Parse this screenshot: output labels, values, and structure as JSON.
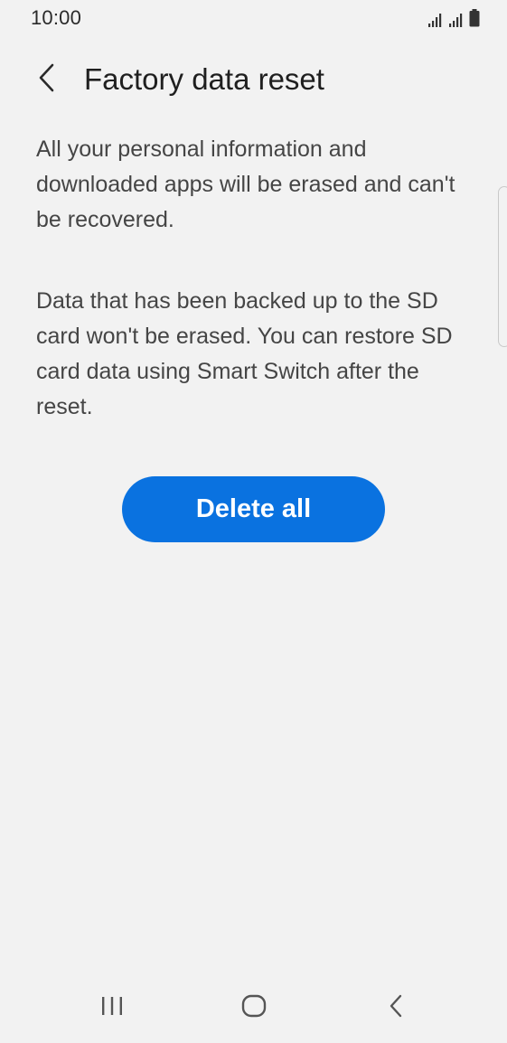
{
  "status_bar": {
    "time": "10:00",
    "icons": [
      "signal-icon",
      "signal-icon",
      "battery-icon"
    ]
  },
  "app_bar": {
    "back_icon": "chevron-left-icon",
    "title": "Factory data reset"
  },
  "content": {
    "paragraph_1": "All your personal information and downloaded apps will be erased and can't be recovered.",
    "paragraph_2": "Data that has been backed up to the SD card won't be erased. You can restore SD card data using Smart Switch after the reset."
  },
  "actions": {
    "delete_all_label": "Delete all"
  },
  "nav_bar": {
    "icons": [
      "recents-icon",
      "home-icon",
      "back-icon"
    ]
  },
  "colors": {
    "background": "#f2f2f2",
    "accent": "#0a72e0",
    "button_text": "#ffffff",
    "body_text": "#454545"
  }
}
